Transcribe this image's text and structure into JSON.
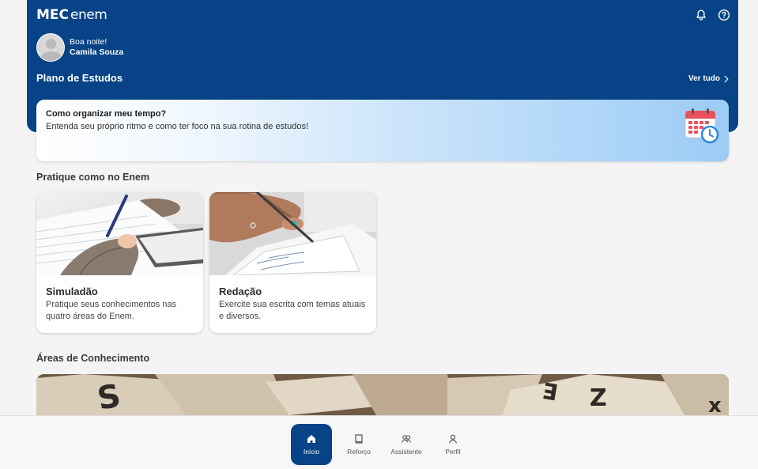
{
  "header": {
    "logo_mec": "MEC",
    "logo_enem": "enem",
    "greeting": "Boa noite!",
    "user_name": "Camila Souza",
    "plan_title": "Plano de Estudos",
    "see_all": "Ver tudo"
  },
  "tip": {
    "title": "Como organizar meu tempo?",
    "subtitle": "Entenda seu próprio ritmo e como ter foco na sua rotina de estudos!"
  },
  "practice": {
    "title": "Pratique como no Enem",
    "cards": [
      {
        "title": "Simuladão",
        "description": "Pratique seus conhecimentos nas quatro áreas do Enem."
      },
      {
        "title": "Redação",
        "description": "Exercite sua escrita com temas atuais e diversos."
      }
    ]
  },
  "areas": {
    "title": "Áreas de Conhecimento"
  },
  "nav": {
    "items": [
      {
        "label": "Início",
        "icon": "home-icon",
        "active": true
      },
      {
        "label": "Reforço",
        "icon": "book-icon",
        "active": false
      },
      {
        "label": "Assistente",
        "icon": "people-icon",
        "active": false
      },
      {
        "label": "Perfil",
        "icon": "user-icon",
        "active": false
      }
    ]
  },
  "colors": {
    "primary": "#074386",
    "background": "#f4f4f4"
  }
}
